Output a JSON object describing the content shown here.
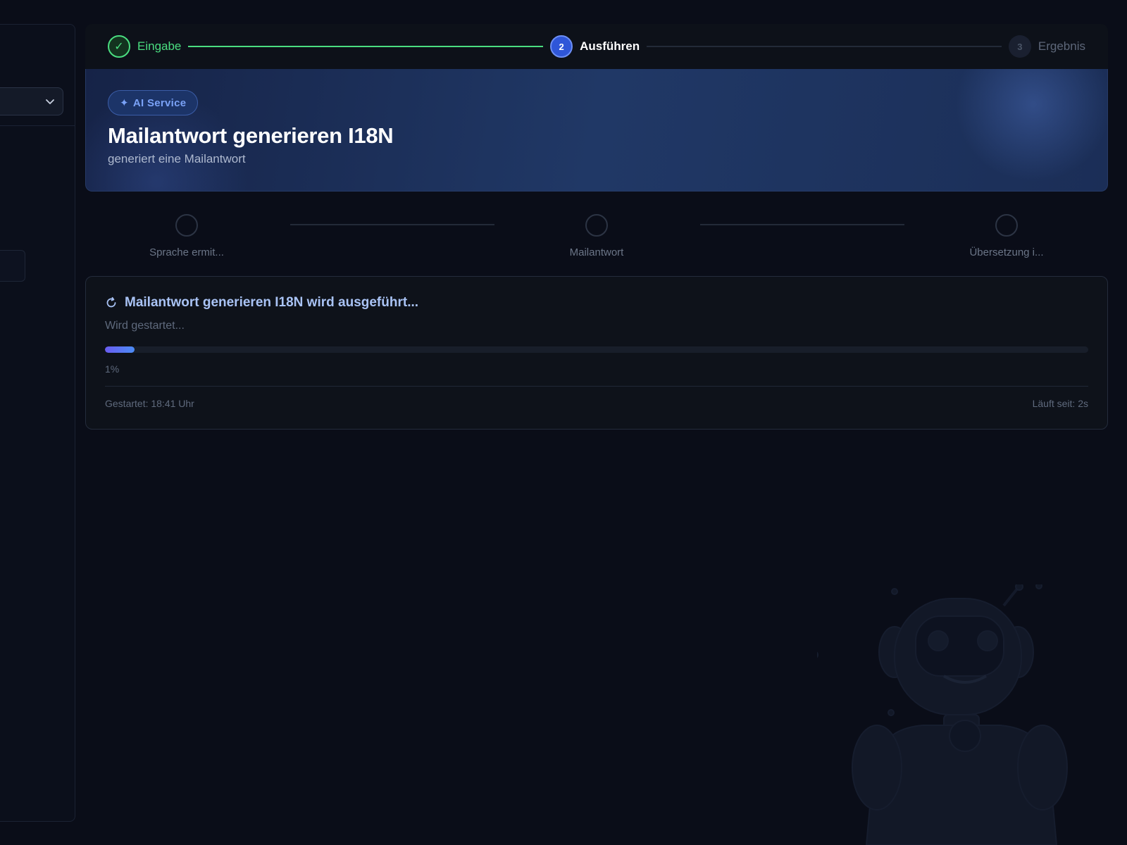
{
  "stepper": {
    "steps": [
      {
        "number": "✓",
        "label": "Eingabe",
        "state": "done"
      },
      {
        "number": "2",
        "label": "Ausführen",
        "state": "active"
      },
      {
        "number": "3",
        "label": "Ergebnis",
        "state": "todo"
      }
    ]
  },
  "hero": {
    "badge": "AI Service",
    "badge_icon": "sparkle-icon",
    "title": "Mailantwort generieren I18N",
    "subtitle": "generiert eine Mailantwort"
  },
  "substeps": [
    {
      "label": "Sprache ermit..."
    },
    {
      "label": "Mailantwort"
    },
    {
      "label": "Übersetzung i..."
    }
  ],
  "progress": {
    "title": "Mailantwort generieren I18N wird ausgeführt...",
    "status": "Wird gestartet...",
    "value": 0.01,
    "percent_label": "1%",
    "started": "Gestartet: 18:41 Uhr",
    "elapsed": "Läuft seit: 2s"
  },
  "colors": {
    "background": "#0a0d18",
    "success": "#4ade80",
    "active": "#2f56d8",
    "accent": "#7aa2f7"
  }
}
